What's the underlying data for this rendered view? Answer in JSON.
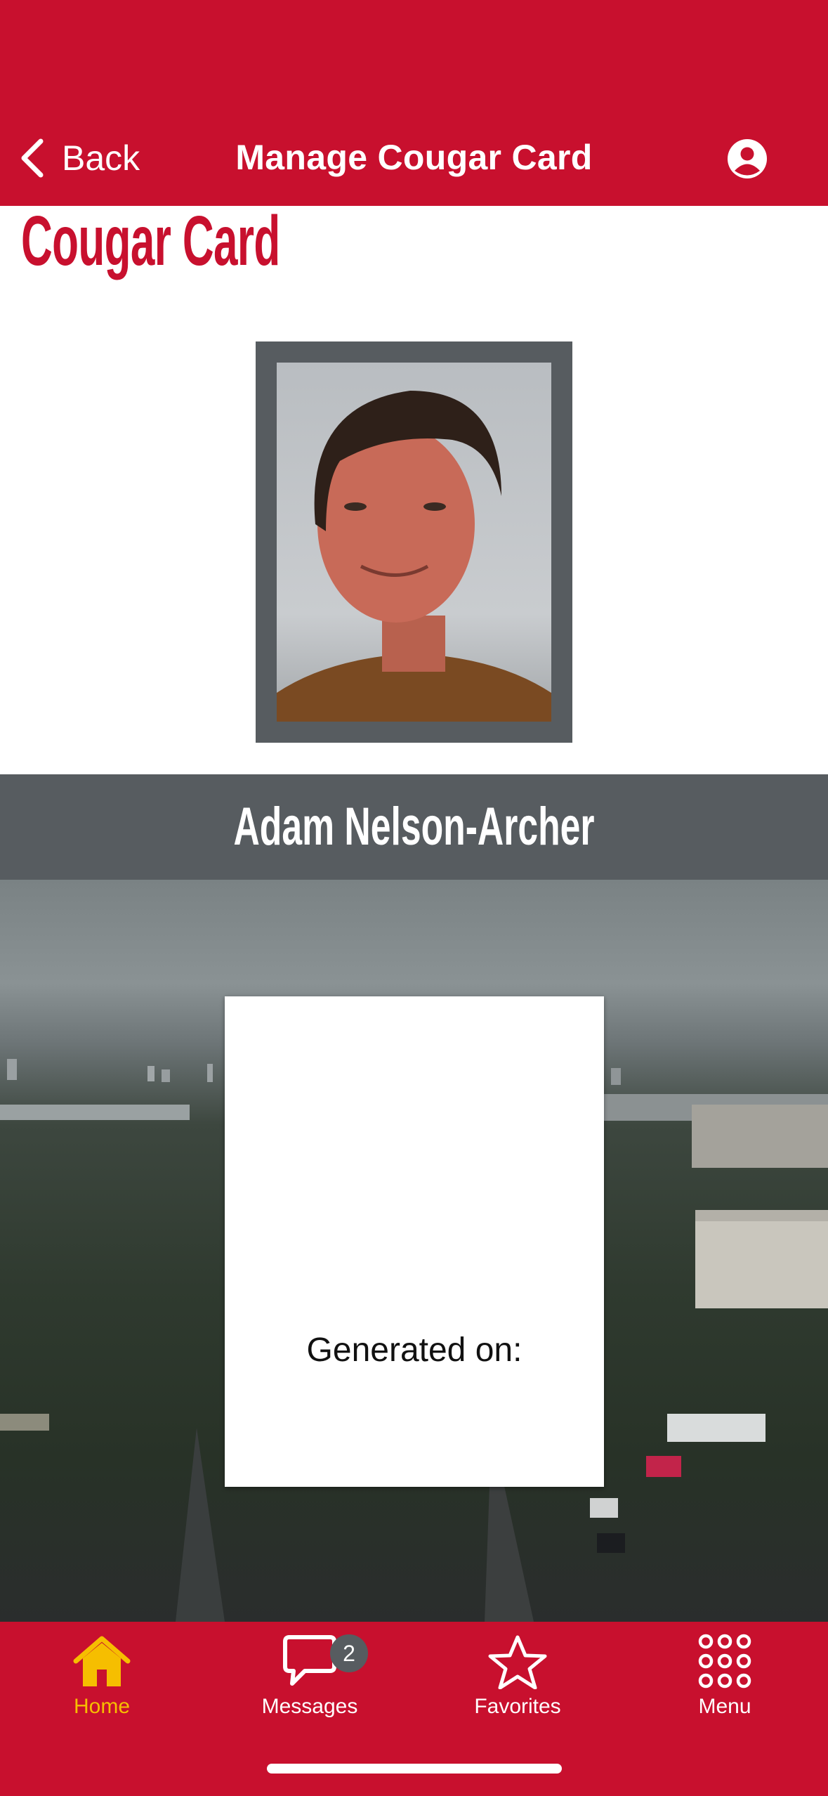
{
  "header": {
    "back_label": "Back",
    "title": "Manage Cougar Card",
    "profile_icon": "user-circle-icon"
  },
  "page": {
    "title": "Cougar Card"
  },
  "card": {
    "holder_name": "Adam Nelson-Archer",
    "generated_label": "Generated on:"
  },
  "tabbar": {
    "tabs": [
      {
        "label": "Home",
        "icon": "home-icon",
        "active": true
      },
      {
        "label": "Messages",
        "icon": "chat-bubble-icon",
        "badge": "2"
      },
      {
        "label": "Favorites",
        "icon": "star-icon"
      },
      {
        "label": "Menu",
        "icon": "grid-icon"
      }
    ]
  },
  "colors": {
    "brand_red": "#c8102e",
    "slate": "#575c60",
    "active_tab": "#f6be00"
  }
}
